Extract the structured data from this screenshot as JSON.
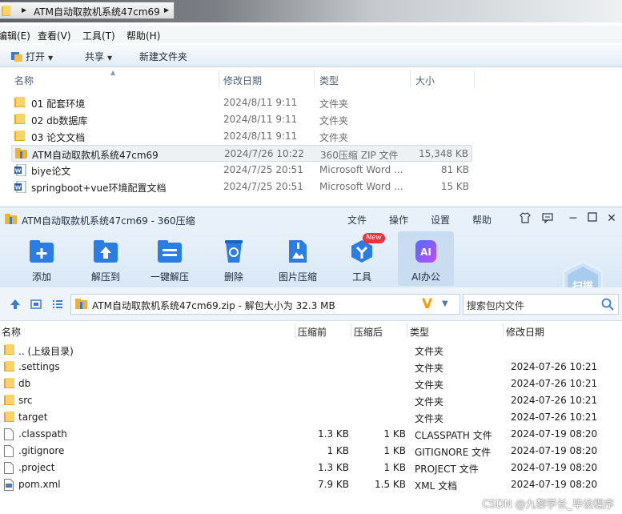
{
  "explorer": {
    "address_path": "ATM自动取款机系统47cm69",
    "menu": [
      "编辑(E)",
      "查看(V)",
      "工具(T)",
      "帮助(H)"
    ],
    "toolbar": {
      "open": "打开",
      "share": "共享",
      "new_folder": "新建文件夹"
    },
    "columns": {
      "name": "名称",
      "date": "修改日期",
      "type": "类型",
      "size": "大小"
    },
    "rows": [
      {
        "name": "01 配套环境",
        "date": "2024/8/11 9:11",
        "type": "文件夹",
        "size": "",
        "icon": "folder-icon"
      },
      {
        "name": "02 db数据库",
        "date": "2024/8/11 9:11",
        "type": "文件夹",
        "size": "",
        "icon": "folder-icon"
      },
      {
        "name": "03 论文文档",
        "date": "2024/8/11 9:11",
        "type": "文件夹",
        "size": "",
        "icon": "folder-icon"
      },
      {
        "name": "ATM自动取款机系统47cm69",
        "date": "2024/7/26 10:22",
        "type": "360压缩 ZIP 文件",
        "size": "15,348 KB",
        "icon": "zip-icon",
        "selected": true
      },
      {
        "name": "biye论文",
        "date": "2024/7/25 20:51",
        "type": "Microsoft Word ...",
        "size": "81 KB",
        "icon": "word-icon"
      },
      {
        "name": "springboot+vue环境配置文档",
        "date": "2024/7/25 20:51",
        "type": "Microsoft Word ...",
        "size": "15 KB",
        "icon": "word-icon"
      }
    ]
  },
  "zip": {
    "title": "ATM自动取款机系统47cm69 - 360压缩",
    "menu": [
      "文件",
      "操作",
      "设置",
      "帮助"
    ],
    "tools": [
      "添加",
      "解压到",
      "一键解压",
      "删除",
      "图片压缩",
      "工具",
      "AI办公"
    ],
    "new_badge": "New",
    "scan_label": "扫描",
    "path_text": "ATM自动取款机系统47cm69.zip - 解包大小为 32.3 MB",
    "search_placeholder": "搜索包内文件",
    "columns": {
      "name": "名称",
      "compressed_before": "压缩前",
      "compressed_after": "压缩后",
      "type": "类型",
      "modified": "修改日期"
    },
    "rows": [
      {
        "name": ".. (上级目录)",
        "before": "",
        "after": "",
        "type": "文件夹",
        "modified": "",
        "icon": "folder-icon"
      },
      {
        "name": ".settings",
        "before": "",
        "after": "",
        "type": "文件夹",
        "modified": "2024-07-26 10:21",
        "icon": "folder-icon"
      },
      {
        "name": "db",
        "before": "",
        "after": "",
        "type": "文件夹",
        "modified": "2024-07-26 10:21",
        "icon": "folder-icon"
      },
      {
        "name": "src",
        "before": "",
        "after": "",
        "type": "文件夹",
        "modified": "2024-07-26 10:21",
        "icon": "folder-icon"
      },
      {
        "name": "target",
        "before": "",
        "after": "",
        "type": "文件夹",
        "modified": "2024-07-26 10:21",
        "icon": "folder-icon"
      },
      {
        "name": ".classpath",
        "before": "1.3 KB",
        "after": "1 KB",
        "type": "CLASSPATH 文件",
        "modified": "2024-07-19 08:20",
        "icon": "file-icon"
      },
      {
        "name": ".gitignore",
        "before": "1 KB",
        "after": "1 KB",
        "type": "GITIGNORE 文件",
        "modified": "2024-07-19 08:20",
        "icon": "file-icon"
      },
      {
        "name": ".project",
        "before": "1.3 KB",
        "after": "1 KB",
        "type": "PROJECT 文件",
        "modified": "2024-07-19 08:20",
        "icon": "file-icon"
      },
      {
        "name": "pom.xml",
        "before": "7.9 KB",
        "after": "1.5 KB",
        "type": "XML 文档",
        "modified": "2024-07-19 08:20",
        "icon": "xml-file-icon"
      }
    ]
  },
  "watermark": "CSDN @九黎学长_毕设程序"
}
